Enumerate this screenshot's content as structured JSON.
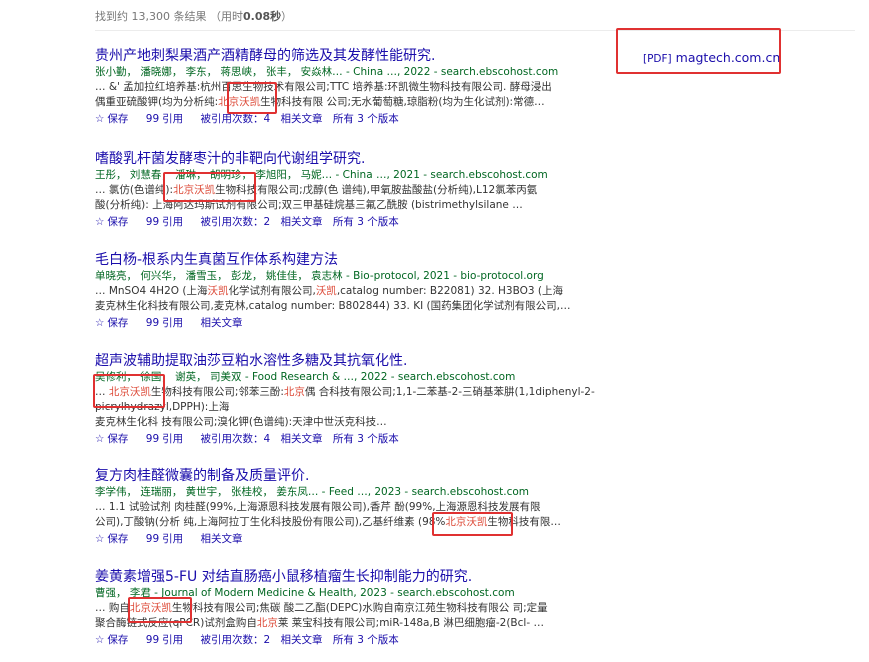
{
  "stats": {
    "text_prefix": "找到约 13,300 条结果",
    "time_label": "（用时",
    "time_value": "0.08秒",
    "time_suffix": "）"
  },
  "pdf": {
    "tag": "[PDF]",
    "domain": "magtech.com.cn"
  },
  "actions": {
    "save": "保存",
    "cite": "引用",
    "related": "相关文章"
  },
  "results": [
    {
      "title": "贵州产地刺梨果酒产酒精酵母的筛选及其发酵性能研究.",
      "authors": "张小勤， 潘晓娜， 李东， 蒋思峡， 张丰， 安焱林… - China …, 2022 - search.ebscohost.com",
      "l1": "… &' 孟加拉红培养基:杭州百思生物技术有限公司;TTC 培养基:环凯微生物科技有限公司. 酵母浸出",
      "l2a": "偶重亚硫酸钾(均为分析纯:",
      "l2hl": "北京沃凯",
      "l2b": "生物科技有限 公司;无水葡萄糖,琼脂粉(均为生化试剂):常德…",
      "cited": "被引用次数：4",
      "versions": "所有 3 个版本"
    },
    {
      "title": "嗜酸乳杆菌发酵枣汁的非靶向代谢组学研究.",
      "authors": "王彤， 刘慧春， 潘琳， 胡明珍， 李旭阳， 马妮… - China …, 2021 - search.ebscohost.com",
      "l1a": "… 氯仿(色谱纯):",
      "l1hl": "北京沃凯",
      "l1b": "生物科技有限公司;戊醇(色 谱纯),甲氧胺盐酸盐(分析纯),L12氯苯丙氨",
      "l2": "酸(分析纯): 上海阿达玛斯试剂有限公司;双三甲基硅烷基三氟乙酰胺 (bistrimethylsilane …",
      "cited": "被引用次数：2",
      "versions": "所有 3 个版本"
    },
    {
      "title": "毛白杨-根系内生真菌互作体系构建方法",
      "authors": "单晓亮， 何兴华， 潘雪玉， 彭龙， 姚佳佳， 袁志林 - Bio-protocol, 2021 - bio-protocol.org",
      "l1a": "… MnSO4 4H2O (上海",
      "l1hl": "沃凯",
      "l1b": "化学试剂有限公司,",
      "l1hl2": "沃凯",
      "l1c": ",catalog number: B22081) 32. H3BO3 (上海",
      "l2": "麦克林生化科技有限公司,麦克林,catalog number: B802844) 33. KI (国药集团化学试剂有限公司,…"
    },
    {
      "title": "超声波辅助提取油莎豆粕水溶性多糖及其抗氧化性.",
      "authors": "吴修利， 徐国， 谢英， 司美双 - Food Research & …, 2022 - search.ebscohost.com",
      "l1a": "… ",
      "l1hl": "北京沃凯",
      "l1b": "生物科技有限公司;邻苯三酚:",
      "l1hl2": "北京",
      "l1c": "偶 合科技有限公司;1,1-二苯基-2-三硝基苯肼(1,1diphenyl-2-",
      "l2": "picrylhydrazyl,DPPH):上海",
      "l3": "麦克林生化科 技有限公司;溴化钾(色谱纯):天津中世沃克科技…",
      "cited": "被引用次数：4",
      "versions": "所有 3 个版本"
    },
    {
      "title": "复方肉桂醛微囊的制备及质量评价.",
      "authors": "李学伟， 连瑞丽， 黄世宇， 张桂校， 姜东凤… - Feed …, 2023 - search.ebscohost.com",
      "l1": "… 1.1 试验试剂 肉桂醛(99%,上海源恩科技发展有限公司),香芹 酚(99%,上海源恩科技发展有限",
      "l2a": "公司),丁酸钠(分析 纯,上海阿拉丁生化科技股份有限公司),乙基纤维素 (98%",
      "l2hl": "北京沃凯",
      "l2b": "生物科技有限…"
    },
    {
      "title": "姜黄素增强5-FU 对结直肠癌小鼠移植瘤生长抑制能力的研究.",
      "authors": "曹强， 李君 - Journal of Modern Medicine & Health, 2023 - search.ebscohost.com",
      "l1a": "… 购自",
      "l1hl": "北京沃凯",
      "l1b": "生物科技有限公司;焦碳 酸二乙酯(DEPC)水购自南京江苑生物科技有限公 司;定量",
      "l2a": "聚合酶链式反应(qPCR)试剂盒购自",
      "l2hl": "北京",
      "l2b": "莱 莱宝科技有限公司;miR-148a,B 淋巴细胞瘤-2(Bcl- …",
      "cited": "被引用次数：2",
      "versions": "所有 3 个版本"
    }
  ]
}
